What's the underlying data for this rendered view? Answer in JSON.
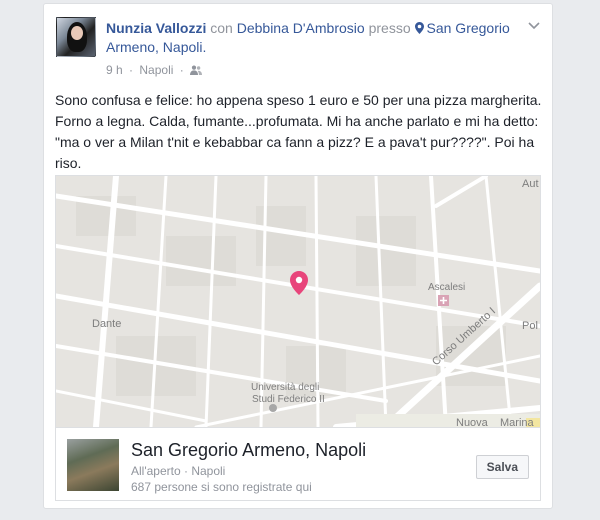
{
  "header": {
    "author": "Nunzia Vallozzi",
    "with_word": "con",
    "tagged_friend": "Debbina D'Ambrosio",
    "at_word": "presso",
    "location": "San Gregorio Armeno, Napoli."
  },
  "meta": {
    "time": "9 h",
    "separator": "·",
    "place": "Napoli",
    "audience_icon": "friends-icon"
  },
  "post": {
    "text": "Sono confusa e felice: ho appena speso 1 euro e 50 per una pizza margherita. Forno a legna. Calda, fumante...profumata. Mi ha anche parlato e mi ha detto: \"ma o ver a Milan t'nit e kebabbar ca fann a pizz? E a pava't pur????\". Poi ha riso."
  },
  "map": {
    "labels": {
      "dante": "Dante",
      "universita_1": "Università degli",
      "universita_2": "Studi Federico II",
      "ascalesi": "Ascalesi",
      "corso_umberto": "Corso Umberto I",
      "marina": "Marina",
      "pol": "Pol",
      "aut": "Aut",
      "nuova": "Nuova"
    },
    "pin_color": "#e8457b"
  },
  "place": {
    "name": "San Gregorio Armeno, Napoli",
    "category": "All'aperto · Napoli",
    "checkins": "687 persone si sono registrate qui",
    "save_label": "Salva"
  },
  "colors": {
    "link": "#365899",
    "muted": "#90949c",
    "background": "#e9ebee"
  }
}
